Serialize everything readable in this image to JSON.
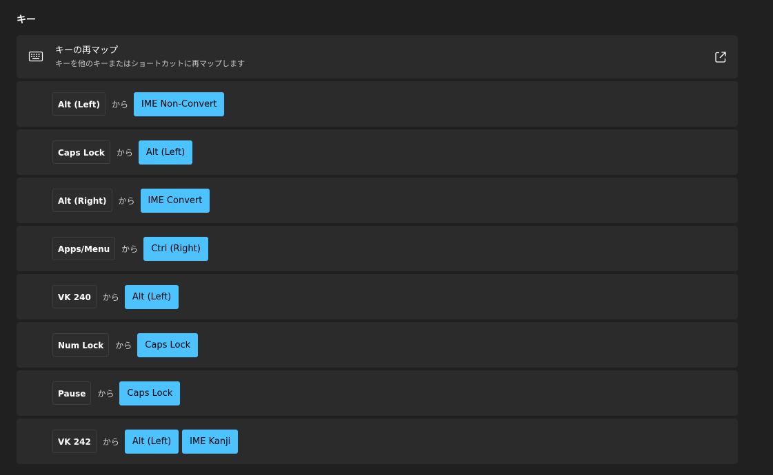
{
  "section": {
    "title": "キー"
  },
  "remap": {
    "title": "キーの再マップ",
    "subtitle": "キーを他のキーまたはショートカットに再マップします",
    "icon": "keyboard-icon",
    "action_icon": "open-external-icon"
  },
  "mappings": [
    {
      "from": "Alt (Left)",
      "connector": "から",
      "to": [
        "IME Non-Convert"
      ]
    },
    {
      "from": "Caps Lock",
      "connector": "から",
      "to": [
        "Alt (Left)"
      ]
    },
    {
      "from": "Alt (Right)",
      "connector": "から",
      "to": [
        "IME Convert"
      ]
    },
    {
      "from": "Apps/Menu",
      "connector": "から",
      "to": [
        "Ctrl (Right)"
      ]
    },
    {
      "from": "VK 240",
      "connector": "から",
      "to": [
        "Alt (Left)"
      ]
    },
    {
      "from": "Num Lock",
      "connector": "から",
      "to": [
        "Caps Lock"
      ]
    },
    {
      "from": "Pause",
      "connector": "から",
      "to": [
        "Caps Lock"
      ]
    },
    {
      "from": "VK 242",
      "connector": "から",
      "to": [
        "Alt (Left)",
        "IME Kanji"
      ]
    }
  ],
  "colors": {
    "background": "#202020",
    "card": "#2b2b2b",
    "accent": "#4cc2ff"
  }
}
